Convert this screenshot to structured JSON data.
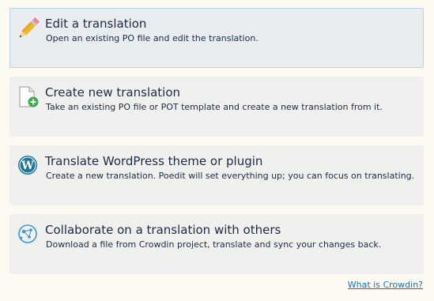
{
  "options": [
    {
      "title": "Edit a translation",
      "description": "Open an existing PO file and edit the translation.",
      "icon": "pencil-icon"
    },
    {
      "title": "Create new translation",
      "description": "Take an existing PO file or POT template and create a new translation from it.",
      "icon": "new-file-plus-icon"
    },
    {
      "title": "Translate WordPress theme or plugin",
      "description": "Create a new translation. Poedit will set everything up; you can focus on translating.",
      "icon": "wordpress-icon"
    },
    {
      "title": "Collaborate on a translation with others",
      "description": "Download a file from Crowdin project, translate and sync your changes back.",
      "icon": "crowdin-icon"
    }
  ],
  "footer": {
    "crowdin_link": "What is Crowdin?"
  },
  "colors": {
    "background": "#fdfbf1",
    "card": "#f0f0ee",
    "selected_border": "#b7d4e8",
    "link": "#1a6fc2",
    "text": "#1d2a44"
  }
}
